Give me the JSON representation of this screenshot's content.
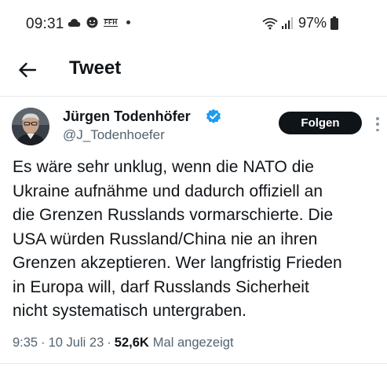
{
  "status_bar": {
    "time": "09:31",
    "left_icons": [
      "cloud-icon",
      "face-icon",
      "ffh-app-icon",
      "notification-dot-icon"
    ],
    "ffh_label": "FFH",
    "battery": "97%"
  },
  "header": {
    "back_icon": "arrow-left-icon",
    "title": "Tweet"
  },
  "tweet": {
    "author_name": "Jürgen Todenhöfer",
    "handle": "@J_Todenhoefer",
    "verified": true,
    "follow_label": "Folgen",
    "text": "Es wäre sehr unklug, wenn die NATO die\nUkraine aufnähme und dadurch offiziell an\ndie Grenzen Russlands vormarschierte. Die\nUSA würden Russland/China nie an ihren\nGrenzen akzeptieren. Wer langfristig Frieden\nin Europa will, darf Russlands Sicherheit\nnicht systematisch untergraben.",
    "time": "9:35",
    "separator": "·",
    "date": "10 Juli 23",
    "views": "52,6K",
    "views_label": "Mal angezeigt"
  },
  "colors": {
    "text_primary": "#0f1419",
    "text_secondary": "#536471",
    "verified_blue": "#1d9bf0",
    "button_bg": "#0f1419"
  }
}
